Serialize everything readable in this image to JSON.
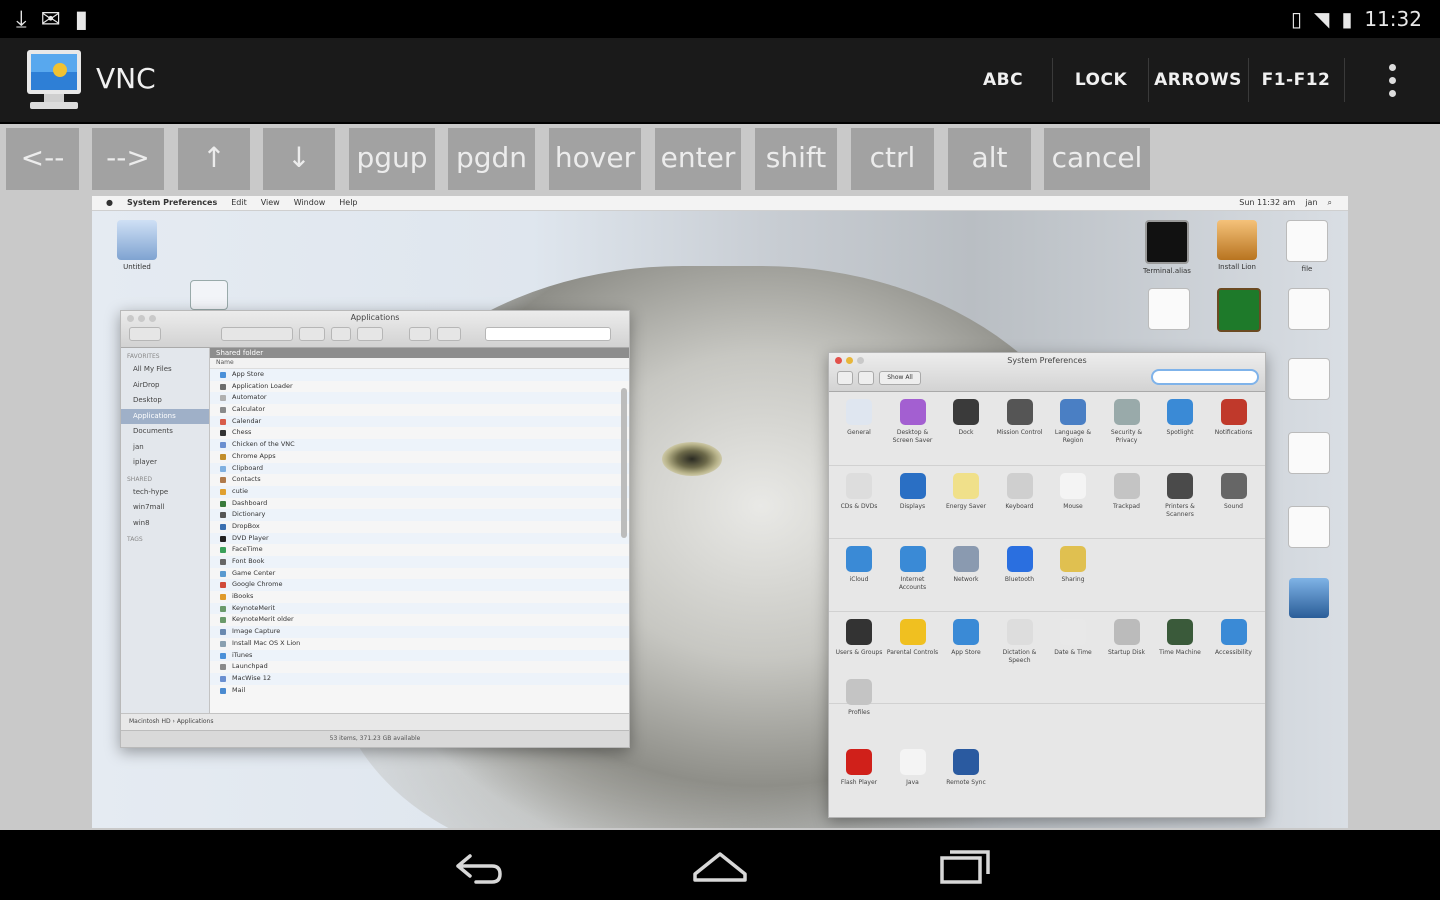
{
  "status_bar": {
    "time": "11:32",
    "left_icons": [
      "download-icon",
      "mail-icon",
      "sd-card-icon"
    ],
    "right_icons": [
      "vibrate-icon",
      "wifi-icon",
      "battery-icon"
    ]
  },
  "action_bar": {
    "title": "VNC",
    "buttons": [
      "ABC",
      "LOCK",
      "ARROWS",
      "F1-F12"
    ]
  },
  "keys": [
    "<--",
    "-->",
    "↑",
    "↓",
    "pgup",
    "pgdn",
    "hover",
    "enter",
    "shift",
    "ctrl",
    "alt",
    "cancel"
  ],
  "remote": {
    "menubar": {
      "app": "System Preferences",
      "menus": [
        "Edit",
        "View",
        "Window",
        "Help"
      ],
      "right_items": [
        "Sun 11:32 am",
        "jan"
      ]
    },
    "finder": {
      "title": "Applications",
      "sidebar_favorites_header": "FAVORITES",
      "sidebar_favorites": [
        "All My Files",
        "AirDrop",
        "Desktop",
        "Applications",
        "Documents",
        "jan",
        "iplayer"
      ],
      "sidebar_shared_header": "SHARED",
      "sidebar_shared": [
        "tech-hype",
        "win7mall",
        "win8"
      ],
      "sidebar_tags_header": "TAGS",
      "column_header": "Shared folder",
      "name_header": "Name",
      "rows": [
        "App Store",
        "Application Loader",
        "Automator",
        "Calculator",
        "Calendar",
        "Chess",
        "Chicken of the VNC",
        "Chrome Apps",
        "Clipboard",
        "Contacts",
        "cutie",
        "Dashboard",
        "Dictionary",
        "DropBox",
        "DVD Player",
        "FaceTime",
        "Font Book",
        "Game Center",
        "Google Chrome",
        "iBooks",
        "KeynoteMerit",
        "KeynoteMerit older",
        "Image Capture",
        "Install Mac OS X Lion",
        "iTunes",
        "Launchpad",
        "MacWise 12",
        "Mail"
      ],
      "path": "Macintosh HD › Applications",
      "status": "53 items, 371.23 GB available"
    },
    "syspref": {
      "title": "System Preferences",
      "show_all": "Show All",
      "row1": [
        "General",
        "Desktop & Screen Saver",
        "Dock",
        "Mission Control",
        "Language & Region",
        "Security & Privacy",
        "Spotlight",
        "Notifications"
      ],
      "row2": [
        "CDs & DVDs",
        "Displays",
        "Energy Saver",
        "Keyboard",
        "Mouse",
        "Trackpad",
        "Printers & Scanners",
        "Sound"
      ],
      "row3": [
        "iCloud",
        "Internet Accounts",
        "Network",
        "Bluetooth",
        "Sharing"
      ],
      "row4": [
        "Users & Groups",
        "Parental Controls",
        "App Store",
        "Dictation & Speech",
        "Date & Time",
        "Startup Disk",
        "Time Machine",
        "Accessibility"
      ],
      "row5": [
        "Profiles"
      ],
      "other": [
        "Flash Player",
        "Java",
        "Remote Sync"
      ]
    },
    "desktop_icons": [
      "Untitled",
      "Terminal.alias",
      "Install Lion",
      "file"
    ]
  },
  "colors": {
    "status_bg": "#000000",
    "action_bar_bg": "#1a1a1a",
    "key_bg": "#a2a2a2",
    "key_text": "#ececec"
  }
}
